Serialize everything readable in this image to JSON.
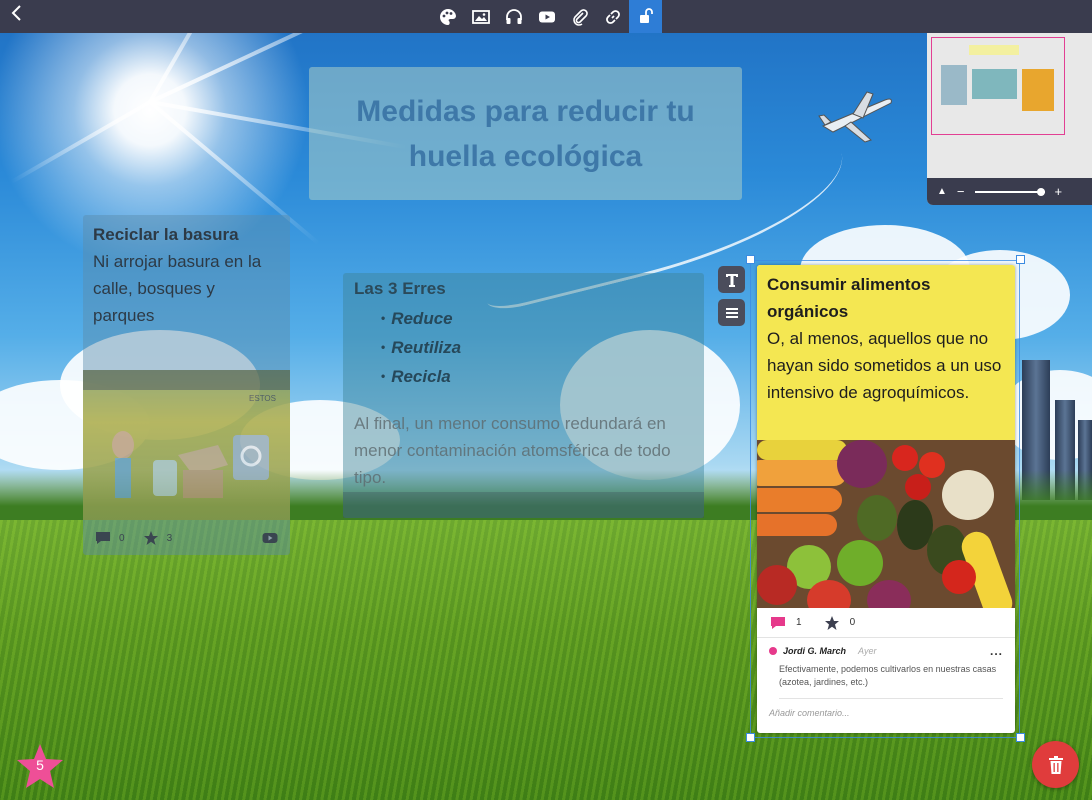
{
  "toolbar": {
    "tools": [
      {
        "name": "palette-icon"
      },
      {
        "name": "image-icon"
      },
      {
        "name": "headphones-icon"
      },
      {
        "name": "youtube-icon"
      },
      {
        "name": "attachment-icon"
      },
      {
        "name": "link-icon"
      },
      {
        "name": "unlock-icon",
        "active": true
      }
    ]
  },
  "title_card": {
    "title": "Medidas para reducir tu huella ecológica"
  },
  "card_recycle": {
    "heading": "Reciclar la basura",
    "body": "Ni arrojar basura en la calle, bosques y parques",
    "image_tag": "ESTOS",
    "comments": "0",
    "stars": "3"
  },
  "card_erres": {
    "heading": "Las 3 Erres",
    "items": [
      "Reduce",
      "Reutiliza",
      "Recicla"
    ],
    "paragraph": "Al final, un menor consumo redundará en menor contaminación atomsférica de todo tipo."
  },
  "card_food": {
    "heading": "Consumir alimentos orgánicos",
    "body": "O, al menos, aquellos que no hayan sido sometidos a un uso intensivo de agroquímicos.",
    "comments": "1",
    "stars": "0",
    "comment": {
      "author": "Jordi G. March",
      "time": "Ayer",
      "more": "...",
      "text": "Efectivamente, podemos cultivarlos en nuestras casas (azotea, jardines, etc.)"
    },
    "add_comment_placeholder": "Añadir comentario..."
  },
  "minimap": {
    "zoom_level": 0.95,
    "up": "▲",
    "minus": "−",
    "plus": "+"
  },
  "star_badge": {
    "count": "5"
  },
  "colors": {
    "toolbar": "#3a3c4e",
    "active_tool": "#2e7dd6",
    "food_card_yellow": "#f4e752",
    "accent_pink": "#e6398b",
    "trash_red": "#e03c3c"
  }
}
